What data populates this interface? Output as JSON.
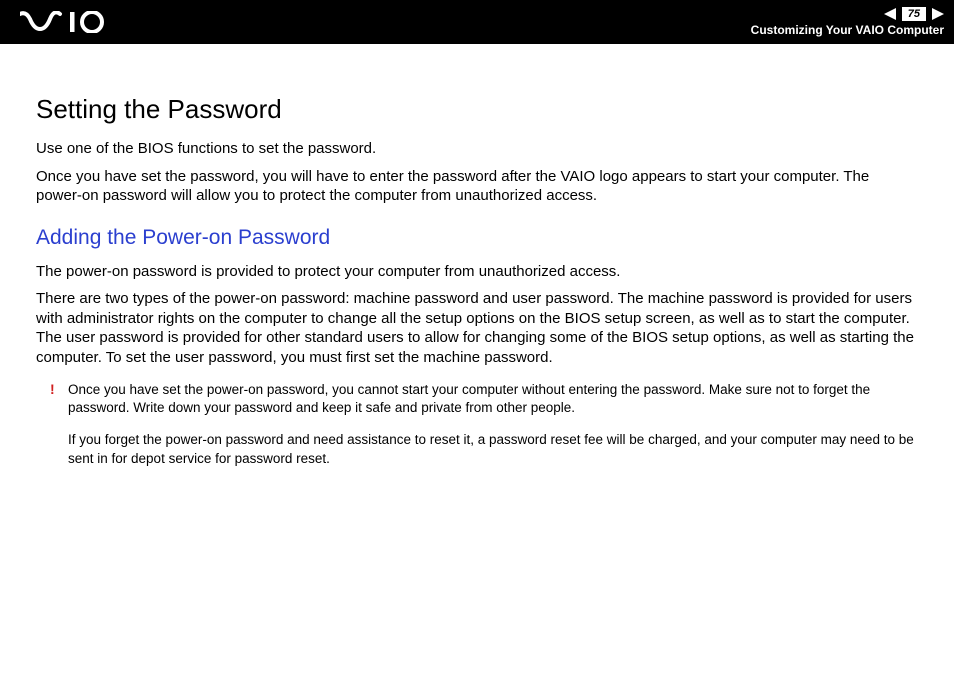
{
  "header": {
    "page_number": "75",
    "section_label": "Customizing Your VAIO Computer"
  },
  "content": {
    "heading": "Setting the Password",
    "intro_1": "Use one of the BIOS functions to set the password.",
    "intro_2": "Once you have set the password, you will have to enter the password after the VAIO logo appears to start your computer. The power-on password will allow you to protect the computer from unauthorized access.",
    "subheading": "Adding the Power-on Password",
    "sub_p1": "The power-on password is provided to protect your computer from unauthorized access.",
    "sub_p2": "There are two types of the power-on password: machine password and user password. The machine password is provided for users with administrator rights on the computer to change all the setup options on the BIOS setup screen, as well as to start the computer. The user password is provided for other standard users to allow for changing some of the BIOS setup options, as well as starting the computer. To set the user password, you must first set the machine password.",
    "note_marker": "!",
    "note_1": "Once you have set the power-on password, you cannot start your computer without entering the password. Make sure not to forget the password. Write down your password and keep it safe and private from other people.",
    "note_2": "If you forget the power-on password and need assistance to reset it, a password reset fee will be charged, and your computer may need to be sent in for depot service for password reset."
  }
}
